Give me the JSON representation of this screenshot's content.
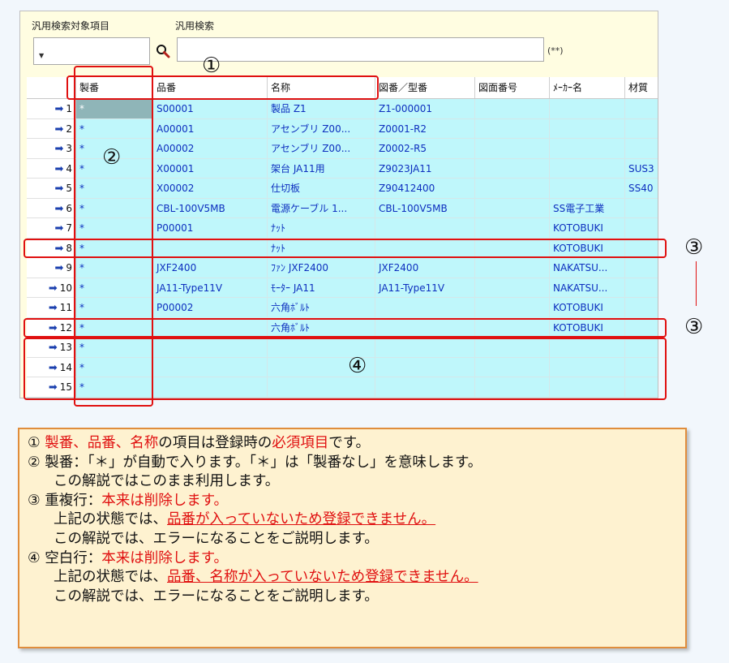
{
  "search": {
    "target_label": "汎用検索対象項目",
    "search_label": "汎用検索",
    "hint": "(**)"
  },
  "columns": [
    "製番",
    "品番",
    "名称",
    "図番／型番",
    "図面番号",
    "ﾒｰｶｰ名",
    "材質"
  ],
  "rows": [
    {
      "no": "1",
      "cells": [
        "*",
        "S00001",
        "製品 Z1",
        "Z1-000001",
        "",
        "",
        ""
      ]
    },
    {
      "no": "2",
      "cells": [
        "*",
        "A00001",
        "アセンブリ Z00...",
        "Z0001-R2",
        "",
        "",
        ""
      ]
    },
    {
      "no": "3",
      "cells": [
        "*",
        "A00002",
        "アセンブリ Z00...",
        "Z0002-R5",
        "",
        "",
        ""
      ]
    },
    {
      "no": "4",
      "cells": [
        "*",
        "X00001",
        "架台 JA11用",
        "Z9023JA11",
        "",
        "",
        "SUS3"
      ]
    },
    {
      "no": "5",
      "cells": [
        "*",
        "X00002",
        "仕切板",
        "Z90412400",
        "",
        "",
        "SS40"
      ]
    },
    {
      "no": "6",
      "cells": [
        "*",
        "CBL-100V5MB",
        "電源ケーブル 1...",
        "CBL-100V5MB",
        "",
        "SS電子工業",
        ""
      ]
    },
    {
      "no": "7",
      "cells": [
        "*",
        "P00001",
        "ﾅｯﾄ",
        "",
        "",
        "KOTOBUKI",
        ""
      ]
    },
    {
      "no": "8",
      "cells": [
        "*",
        "",
        "ﾅｯﾄ",
        "",
        "",
        "KOTOBUKI",
        ""
      ]
    },
    {
      "no": "9",
      "cells": [
        "*",
        "JXF2400",
        "ﾌｧﾝ JXF2400",
        "JXF2400",
        "",
        "NAKATSU...",
        ""
      ]
    },
    {
      "no": "10",
      "cells": [
        "*",
        "JA11-Type11V",
        "ﾓｰﾀｰ JA11",
        "JA11-Type11V",
        "",
        "NAKATSU...",
        ""
      ]
    },
    {
      "no": "11",
      "cells": [
        "*",
        "P00002",
        "六角ﾎﾞﾙﾄ",
        "",
        "",
        "KOTOBUKI",
        ""
      ]
    },
    {
      "no": "12",
      "cells": [
        "*",
        "",
        "六角ﾎﾞﾙﾄ",
        "",
        "",
        "KOTOBUKI",
        ""
      ]
    },
    {
      "no": "13",
      "cells": [
        "*",
        "",
        "",
        "",
        "",
        "",
        ""
      ]
    },
    {
      "no": "14",
      "cells": [
        "*",
        "",
        "",
        "",
        "",
        "",
        ""
      ]
    },
    {
      "no": "15",
      "cells": [
        "*",
        "",
        "",
        "",
        "",
        "",
        ""
      ]
    }
  ],
  "markers": {
    "m1": "①",
    "m2": "②",
    "m3a": "③",
    "m3b": "③",
    "m4": "④"
  },
  "note": {
    "l1": {
      "a": "① ",
      "b": "製番、品番、名称",
      "c": "の項目は登録時の",
      "d": "必須項目",
      "e": "です。"
    },
    "l2": "② 製番：「＊」が自動で入ります。「＊」は「製番なし」を意味します。",
    "l3": "この解説ではこのまま利用します。",
    "l4": {
      "a": "③ 重複行：",
      "b": "本来は削除します。"
    },
    "l5": {
      "a": "上記の状態では、",
      "b": "品番が入っていないため登録できません。"
    },
    "l6": "この解説では、エラーになることをご説明します。",
    "l7": {
      "a": "④ 空白行：",
      "b": "本来は削除します。"
    },
    "l8": {
      "a": "上記の状態では、",
      "b": "品番、名称が入っていないため登録できません。"
    },
    "l9": "この解説では、エラーになることをご説明します。"
  },
  "colors": {
    "row_bg": "#bff7fb",
    "accent_red": "#e01010",
    "note_bg": "#fef2d0",
    "note_border": "#e08d3c"
  }
}
